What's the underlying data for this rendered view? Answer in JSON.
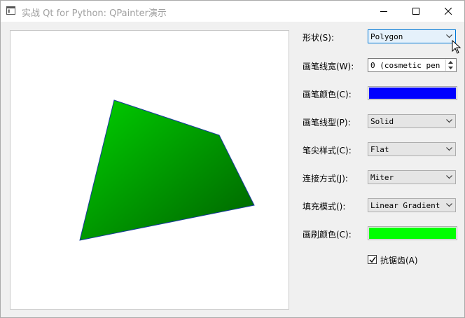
{
  "window": {
    "title": "实战 Qt for Python: QPainter演示"
  },
  "colors": {
    "pen": "#0000ff",
    "brush": "#00ff00",
    "gradient_start": "#00d000",
    "gradient_end": "#006000",
    "outline": "#1a3aa0"
  },
  "controls": {
    "shape": {
      "label": "形状(S):",
      "value": "Polygon"
    },
    "pen_width": {
      "label": "画笔线宽(W):",
      "value": "0 (cosmetic pen"
    },
    "pen_color": {
      "label": "画笔颜色(C):"
    },
    "pen_style": {
      "label": "画笔线型(P):",
      "value": "Solid"
    },
    "pen_cap": {
      "label": "笔尖样式(C):",
      "value": "Flat"
    },
    "pen_join": {
      "label": "连接方式(J):",
      "value": "Miter"
    },
    "fill_mode": {
      "label": "填充模式():",
      "value": "Linear Gradient"
    },
    "brush_color": {
      "label": "画刷颜色(C):"
    },
    "antialias": {
      "label": "抗锯齿(A)",
      "checked": true
    }
  }
}
